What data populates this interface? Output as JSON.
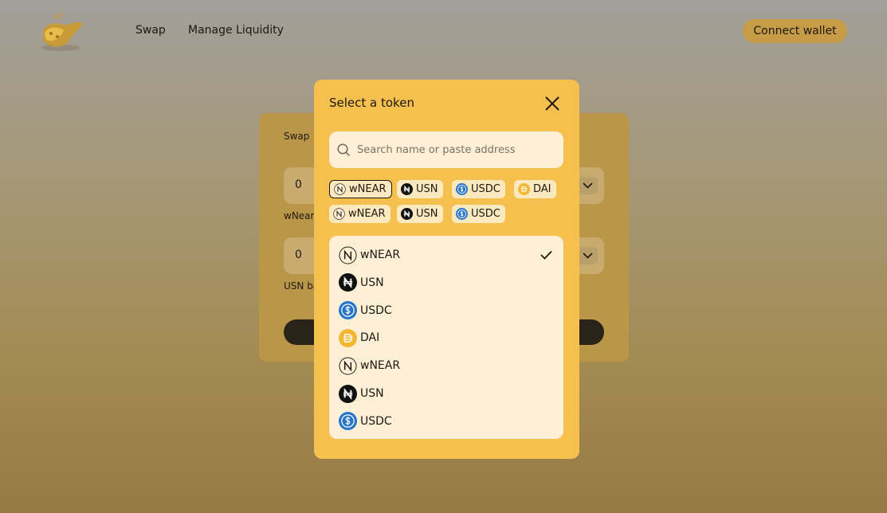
{
  "header": {
    "nav": {
      "swap": "Swap",
      "manage_liquidity": "Manage Liquidity"
    },
    "connect_wallet": "Connect wallet"
  },
  "swap_card": {
    "title": "Swap",
    "from_value": "0",
    "from_balance_label": "wNear",
    "to_value": "0",
    "to_balance_label": "USN ba"
  },
  "modal": {
    "title": "Select a token",
    "search_placeholder": "Search name or paste address",
    "quick_tokens": [
      {
        "symbol": "wNEAR",
        "icon": "wnear-icon",
        "selected": true
      },
      {
        "symbol": "USN",
        "icon": "usn-icon"
      },
      {
        "symbol": "USDC",
        "icon": "usdc-icon"
      },
      {
        "symbol": "DAI",
        "icon": "dai-icon"
      },
      {
        "symbol": "wNEAR",
        "icon": "wnear-icon"
      },
      {
        "symbol": "USN",
        "icon": "usn-icon"
      },
      {
        "symbol": "USDC",
        "icon": "usdc-icon"
      }
    ],
    "token_list": [
      {
        "symbol": "wNEAR",
        "icon": "wnear-icon",
        "selected": true
      },
      {
        "symbol": "USN",
        "icon": "usn-icon"
      },
      {
        "symbol": "USDC",
        "icon": "usdc-icon"
      },
      {
        "symbol": "DAI",
        "icon": "dai-icon"
      },
      {
        "symbol": "wNEAR",
        "icon": "wnear-icon"
      },
      {
        "symbol": "USN",
        "icon": "usn-icon"
      },
      {
        "symbol": "USDC",
        "icon": "usdc-icon"
      }
    ]
  },
  "colors": {
    "modal_bg": "#f5c04e",
    "connect_button": "#c69d46",
    "usdc_blue": "#2775ca",
    "dai_orange": "#f4b731"
  }
}
